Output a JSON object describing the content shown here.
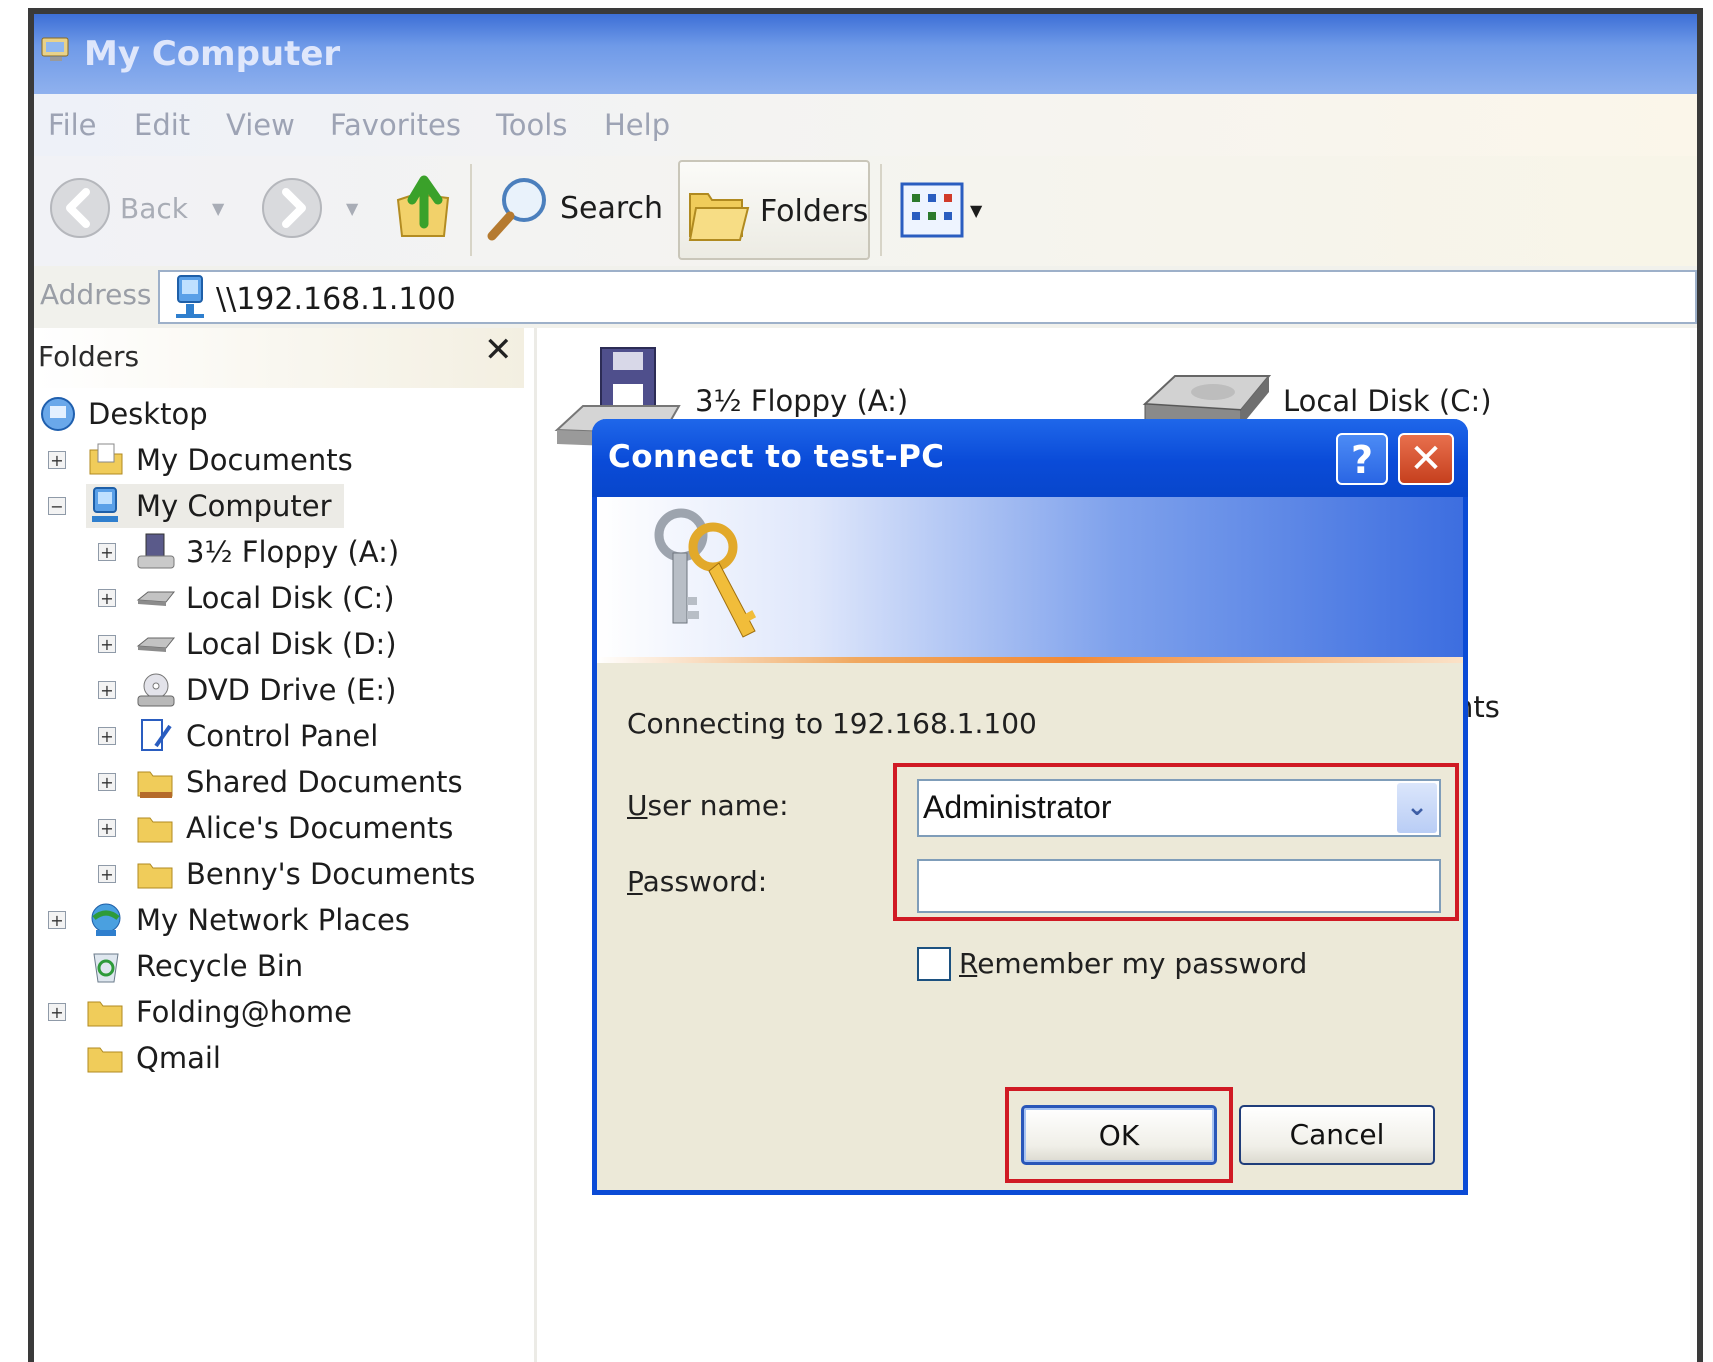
{
  "window": {
    "title": "My Computer"
  },
  "menu": [
    "File",
    "Edit",
    "View",
    "Favorites",
    "Tools",
    "Help"
  ],
  "toolbar": {
    "back_label": "Back",
    "search_label": "Search",
    "folders_label": "Folders"
  },
  "address": {
    "label": "Address",
    "value": "\\\\192.168.1.100"
  },
  "folders_pane": {
    "title": "Folders",
    "close": "✕",
    "tree": [
      {
        "label": "Desktop"
      },
      {
        "label": "My Documents"
      },
      {
        "label": "My Computer"
      },
      {
        "label": "3½ Floppy (A:)"
      },
      {
        "label": "Local Disk (C:)"
      },
      {
        "label": "Local Disk (D:)"
      },
      {
        "label": "DVD Drive (E:)"
      },
      {
        "label": "Control Panel"
      },
      {
        "label": "Shared Documents"
      },
      {
        "label": "Alice's Documents"
      },
      {
        "label": "Benny's Documents"
      },
      {
        "label": "My Network Places"
      },
      {
        "label": "Recycle Bin"
      },
      {
        "label": "Folding@home"
      },
      {
        "label": "Qmail"
      }
    ]
  },
  "content": {
    "floppy_label": "3½ Floppy (A:)",
    "disk_c_label": "Local Disk (C:)",
    "partial_label": "nts"
  },
  "dialog": {
    "title": "Connect to test-PC",
    "help": "?",
    "close": "✕",
    "connecting_text": "Connecting to 192.168.1.100",
    "username_label_u": "U",
    "username_label_rest": "ser name:",
    "username_value": "Administrator",
    "password_label_u": "P",
    "password_label_rest": "assword:",
    "password_value": "",
    "remember_u": "R",
    "remember_rest": "emember my password",
    "remember_checked": false,
    "ok_label": "OK",
    "cancel_label": "Cancel"
  },
  "highlight_color": "#d01a24"
}
